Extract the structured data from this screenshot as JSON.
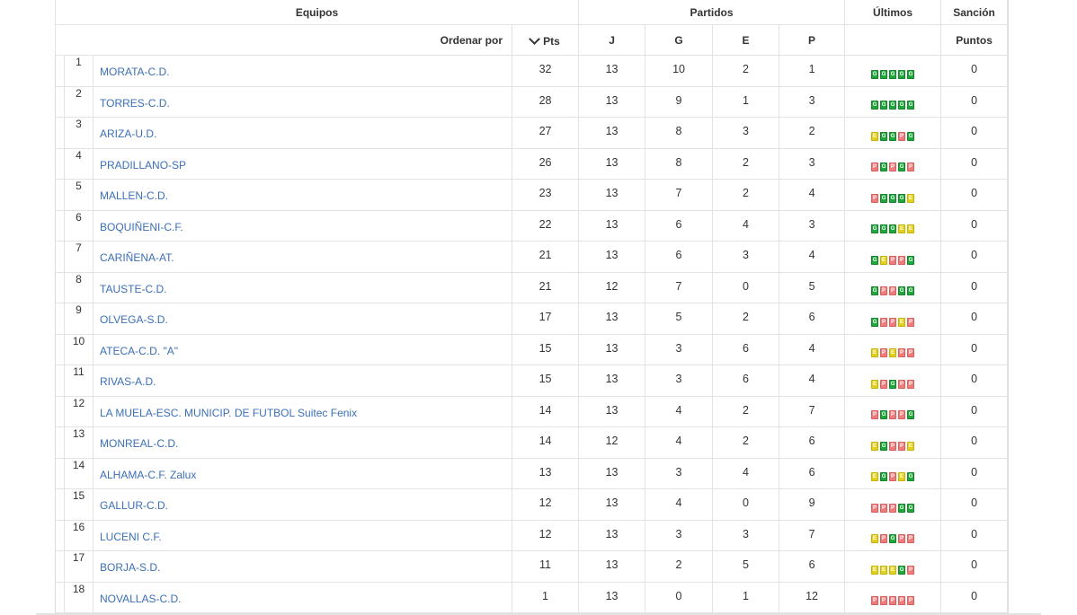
{
  "header": {
    "equipos": "Equipos",
    "partidos": "Partidos",
    "ultimos": "Últimos",
    "sancion": "Sanción",
    "ordenar_por": "Ordenar por",
    "pts": "Pts",
    "j": "J",
    "g": "G",
    "e": "E",
    "p": "P",
    "puntos": "Puntos"
  },
  "colors": {
    "win": "#1fa83a",
    "draw": "#e3d019",
    "loss": "#f07b7b",
    "link": "#3b6fb6"
  },
  "rows": [
    {
      "pos": "1",
      "team": "MORATA-C.D.",
      "pts": "32",
      "j": "13",
      "g": "10",
      "e": "2",
      "p": "1",
      "last": [
        "G",
        "G",
        "G",
        "G",
        "G"
      ],
      "sancion": "0"
    },
    {
      "pos": "2",
      "team": "TORRES-C.D.",
      "pts": "28",
      "j": "13",
      "g": "9",
      "e": "1",
      "p": "3",
      "last": [
        "G",
        "G",
        "G",
        "G",
        "G"
      ],
      "sancion": "0"
    },
    {
      "pos": "3",
      "team": "ARIZA-U.D.",
      "pts": "27",
      "j": "13",
      "g": "8",
      "e": "3",
      "p": "2",
      "last": [
        "E",
        "G",
        "G",
        "P",
        "G"
      ],
      "sancion": "0"
    },
    {
      "pos": "4",
      "team": "PRADILLANO-SP",
      "pts": "26",
      "j": "13",
      "g": "8",
      "e": "2",
      "p": "3",
      "last": [
        "P",
        "G",
        "P",
        "G",
        "P"
      ],
      "sancion": "0"
    },
    {
      "pos": "5",
      "team": "MALLEN-C.D.",
      "pts": "23",
      "j": "13",
      "g": "7",
      "e": "2",
      "p": "4",
      "last": [
        "P",
        "G",
        "G",
        "G",
        "E"
      ],
      "sancion": "0"
    },
    {
      "pos": "6",
      "team": "BOQUIÑENI-C.F.",
      "pts": "22",
      "j": "13",
      "g": "6",
      "e": "4",
      "p": "3",
      "last": [
        "G",
        "G",
        "G",
        "E",
        "E"
      ],
      "sancion": "0"
    },
    {
      "pos": "7",
      "team": "CARIÑENA-AT.",
      "pts": "21",
      "j": "13",
      "g": "6",
      "e": "3",
      "p": "4",
      "last": [
        "G",
        "E",
        "P",
        "P",
        "G"
      ],
      "sancion": "0"
    },
    {
      "pos": "8",
      "team": "TAUSTE-C.D.",
      "pts": "21",
      "j": "12",
      "g": "7",
      "e": "0",
      "p": "5",
      "last": [
        "G",
        "P",
        "P",
        "G",
        "G"
      ],
      "sancion": "0"
    },
    {
      "pos": "9",
      "team": "OLVEGA-S.D.",
      "pts": "17",
      "j": "13",
      "g": "5",
      "e": "2",
      "p": "6",
      "last": [
        "G",
        "P",
        "P",
        "E",
        "P"
      ],
      "sancion": "0"
    },
    {
      "pos": "10",
      "team": "ATECA-C.D. \"A\"",
      "pts": "15",
      "j": "13",
      "g": "3",
      "e": "6",
      "p": "4",
      "last": [
        "E",
        "P",
        "E",
        "P",
        "P"
      ],
      "sancion": "0"
    },
    {
      "pos": "11",
      "team": "RIVAS-A.D.",
      "pts": "15",
      "j": "13",
      "g": "3",
      "e": "6",
      "p": "4",
      "last": [
        "E",
        "P",
        "G",
        "P",
        "P"
      ],
      "sancion": "0"
    },
    {
      "pos": "12",
      "team": "LA MUELA-ESC. MUNICIP. DE FUTBOL Suitec Fenix",
      "pts": "14",
      "j": "13",
      "g": "4",
      "e": "2",
      "p": "7",
      "last": [
        "P",
        "G",
        "P",
        "P",
        "G"
      ],
      "sancion": "0"
    },
    {
      "pos": "13",
      "team": "MONREAL-C.D.",
      "pts": "14",
      "j": "12",
      "g": "4",
      "e": "2",
      "p": "6",
      "last": [
        "E",
        "G",
        "P",
        "P",
        "E"
      ],
      "sancion": "0"
    },
    {
      "pos": "14",
      "team": "ALHAMA-C.F. Zalux",
      "pts": "13",
      "j": "13",
      "g": "3",
      "e": "4",
      "p": "6",
      "last": [
        "E",
        "G",
        "P",
        "E",
        "G"
      ],
      "sancion": "0"
    },
    {
      "pos": "15",
      "team": "GALLUR-C.D.",
      "pts": "12",
      "j": "13",
      "g": "4",
      "e": "0",
      "p": "9",
      "last": [
        "P",
        "P",
        "P",
        "G",
        "G"
      ],
      "sancion": "0"
    },
    {
      "pos": "16",
      "team": "LUCENI C.F.",
      "pts": "12",
      "j": "13",
      "g": "3",
      "e": "3",
      "p": "7",
      "last": [
        "E",
        "P",
        "G",
        "P",
        "P"
      ],
      "sancion": "0"
    },
    {
      "pos": "17",
      "team": "BORJA-S.D.",
      "pts": "11",
      "j": "13",
      "g": "2",
      "e": "5",
      "p": "6",
      "last": [
        "E",
        "E",
        "E",
        "G",
        "P"
      ],
      "sancion": "0"
    },
    {
      "pos": "18",
      "team": "NOVALLAS-C.D.",
      "pts": "1",
      "j": "13",
      "g": "0",
      "e": "1",
      "p": "12",
      "last": [
        "P",
        "P",
        "P",
        "P",
        "P"
      ],
      "sancion": "0"
    }
  ]
}
